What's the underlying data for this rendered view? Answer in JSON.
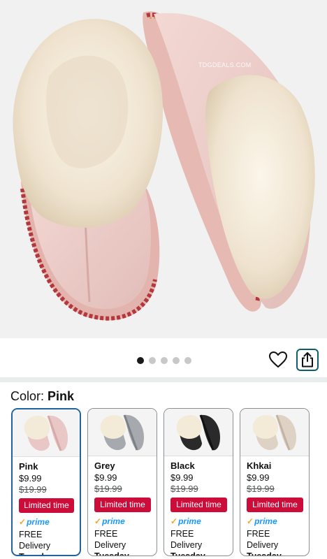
{
  "product": {
    "watermark": "TDGDEALS.COM",
    "image_count": 5,
    "active_image": 1
  },
  "actions": {
    "wishlist_icon": "heart-icon",
    "share_icon": "share-icon"
  },
  "color": {
    "label": "Color: ",
    "selected": "Pink"
  },
  "colors": {
    "accent_selected": "#2162a1",
    "deal_red": "#cc0c39",
    "prime_blue": "#1a98ff",
    "share_border": "#0f5f6b"
  },
  "swatches": [
    {
      "name": "Pink",
      "price": "$9.99",
      "list_price": "$19.99",
      "badge": "Limited time",
      "prime": "prime",
      "delivery": "FREE Delivery",
      "day": "Tuesday",
      "tone": "#e9c7c7",
      "sole": "#d7a9a9"
    },
    {
      "name": "Grey",
      "price": "$9.99",
      "list_price": "$19.99",
      "badge": "Limited time",
      "prime": "prime",
      "delivery": "FREE Delivery",
      "day": "Tuesday",
      "tone": "#a6a9ad",
      "sole": "#7d8084"
    },
    {
      "name": "Black",
      "price": "$9.99",
      "list_price": "$19.99",
      "badge": "Limited time",
      "prime": "prime",
      "delivery": "FREE Delivery",
      "day": "Tuesday",
      "tone": "#2a2a2a",
      "sole": "#111111"
    },
    {
      "name": "Khkai",
      "price": "$9.99",
      "list_price": "$19.99",
      "badge": "Limited time",
      "prime": "prime",
      "delivery": "FREE Delivery",
      "day": "Tuesday",
      "tone": "#ddd2c4",
      "sole": "#c2b4a3"
    }
  ]
}
